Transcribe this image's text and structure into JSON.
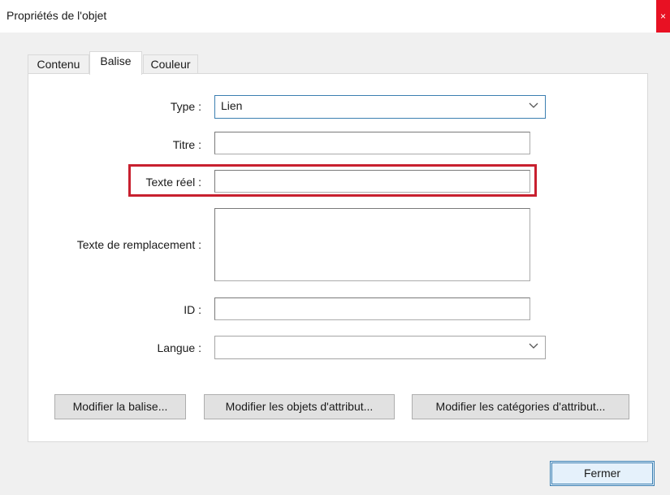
{
  "window": {
    "title": "Propriétés de l'objet",
    "close_label": "×"
  },
  "tabs": [
    {
      "label": "Contenu",
      "active": false
    },
    {
      "label": "Balise",
      "active": true
    },
    {
      "label": "Couleur",
      "active": false
    }
  ],
  "form": {
    "type": {
      "label": "Type :",
      "value": "Lien"
    },
    "titre": {
      "label": "Titre :",
      "value": ""
    },
    "texte_reel": {
      "label": "Texte réel :",
      "value": ""
    },
    "texte_remplacement": {
      "label": "Texte de remplacement :",
      "value": ""
    },
    "id": {
      "label": "ID :",
      "value": ""
    },
    "langue": {
      "label": "Langue :",
      "value": ""
    }
  },
  "buttons": {
    "modifier_balise": "Modifier la balise...",
    "modifier_objets": "Modifier les objets d'attribut...",
    "modifier_categories": "Modifier les catégories d'attribut...",
    "fermer": "Fermer"
  },
  "colors": {
    "highlight": "#c8202f",
    "focus_border": "#3c7fb1",
    "close_button": "#e81123"
  },
  "icons": {
    "dropdown": "chevron-down-icon",
    "close": "close-icon"
  }
}
